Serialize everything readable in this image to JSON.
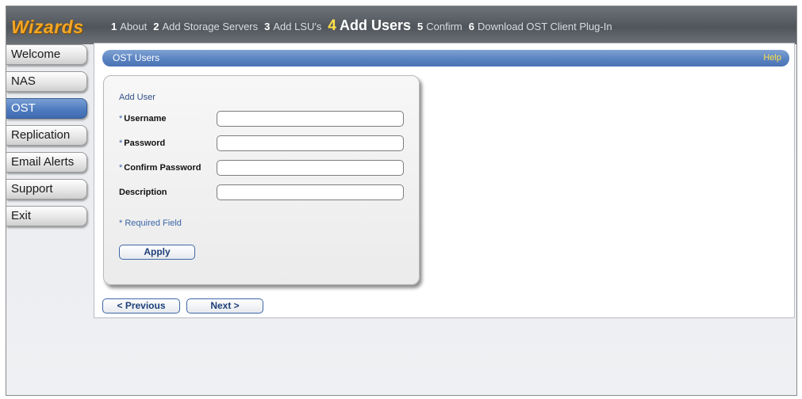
{
  "header": {
    "brand": "Wizards",
    "steps": [
      {
        "num": "1",
        "label": "About"
      },
      {
        "num": "2",
        "label": "Add Storage Servers"
      },
      {
        "num": "3",
        "label": "Add LSU's"
      },
      {
        "num": "4",
        "label": "Add Users"
      },
      {
        "num": "5",
        "label": "Confirm"
      },
      {
        "num": "6",
        "label": "Download OST Client Plug-In"
      }
    ],
    "active_step": "4"
  },
  "sidebar": {
    "items": [
      {
        "label": "Welcome"
      },
      {
        "label": "NAS"
      },
      {
        "label": "OST"
      },
      {
        "label": "Replication"
      },
      {
        "label": "Email Alerts"
      },
      {
        "label": "Support"
      },
      {
        "label": "Exit"
      }
    ],
    "active_item": "OST"
  },
  "panel": {
    "title": "OST Users",
    "help": "Help"
  },
  "form": {
    "title": "Add User",
    "required_marker": "*",
    "fields": {
      "username": {
        "label": "Username",
        "value": ""
      },
      "password": {
        "label": "Password",
        "value": ""
      },
      "confirm_password": {
        "label": "Confirm Password",
        "value": ""
      },
      "description": {
        "label": "Description",
        "value": ""
      }
    },
    "required_note": "* Required Field",
    "apply_label": "Apply"
  },
  "navigation": {
    "previous_label": "< Previous",
    "next_label": "Next >"
  },
  "colors": {
    "brand": "#f5a623",
    "active_step": "#ffe14a",
    "accent_blue": "#4f7cc0",
    "help": "#ffe14a"
  }
}
